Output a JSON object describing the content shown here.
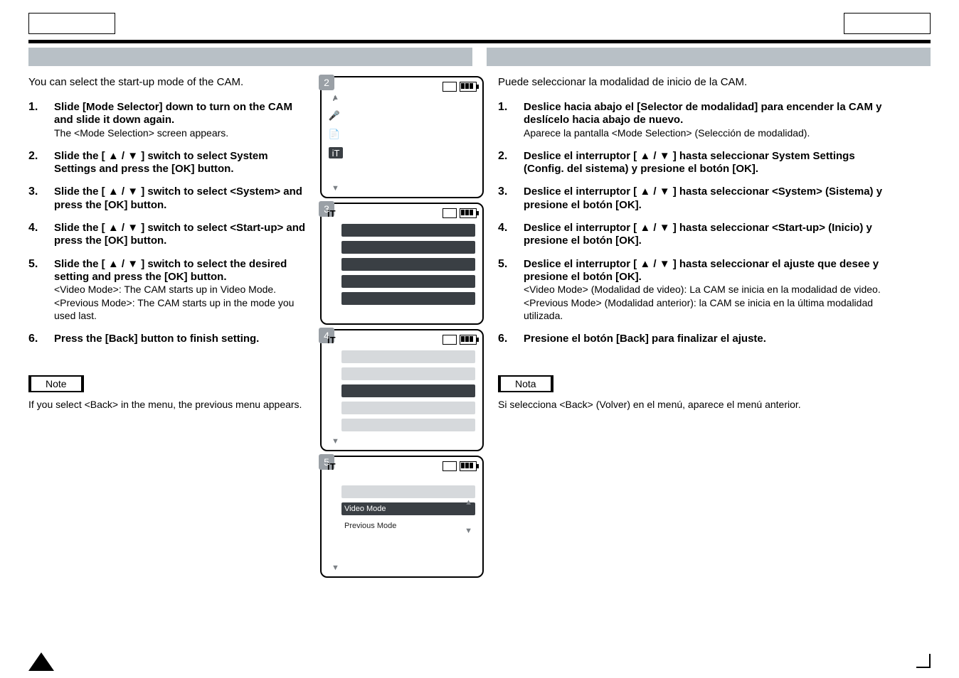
{
  "left": {
    "intro": "You can select the start-up mode of the CAM.",
    "steps": [
      {
        "n": "1.",
        "bold": "Slide [Mode Selector] down to turn on the CAM and slide it down again.",
        "sub": "The <Mode Selection> screen appears."
      },
      {
        "n": "2.",
        "bold": "Slide the [ ▲ / ▼ ] switch to select System Settings and press the [OK] button."
      },
      {
        "n": "3.",
        "bold": "Slide the [ ▲ / ▼ ] switch to select <System> and press the [OK] button."
      },
      {
        "n": "4.",
        "bold": "Slide the [ ▲ / ▼ ] switch to select <Start-up> and press the [OK] button."
      },
      {
        "n": "5.",
        "bold": "Slide the [ ▲ / ▼ ] switch to select the desired setting and press the [OK] button.",
        "sub": "<Video Mode>: The CAM starts up in Video Mode.\n<Previous Mode>: The CAM starts up in the mode you used last."
      },
      {
        "n": "6.",
        "bold": "Press the [Back] button to finish setting."
      }
    ],
    "note_label": "Note",
    "note_text": "If you select <Back> in the menu, the previous menu appears."
  },
  "right": {
    "intro": "Puede seleccionar la modalidad de inicio de la CAM.",
    "steps": [
      {
        "n": "1.",
        "bold": "Deslice hacia abajo el [Selector de modalidad] para encender la CAM y deslícelo hacia abajo de nuevo.",
        "sub": "Aparece la pantalla <Mode Selection> (Selección de modalidad)."
      },
      {
        "n": "2.",
        "bold": "Deslice el interruptor [ ▲ / ▼ ] hasta seleccionar System Settings (Config. del sistema) y presione el botón [OK]."
      },
      {
        "n": "3.",
        "bold": "Deslice el interruptor [ ▲ / ▼ ] hasta seleccionar <System> (Sistema) y presione el botón [OK]."
      },
      {
        "n": "4.",
        "bold": "Deslice el interruptor [ ▲ / ▼ ] hasta seleccionar <Start-up> (Inicio) y presione el botón [OK]."
      },
      {
        "n": "5.",
        "bold": "Deslice el interruptor [ ▲ / ▼ ] hasta seleccionar el ajuste que desee y presione el botón [OK].",
        "sub": "<Video Mode> (Modalidad de video): La CAM se inicia en la modalidad de video.\n<Previous Mode> (Modalidad anterior): la CAM se inicia en la última modalidad utilizada."
      },
      {
        "n": "6.",
        "bold": "Presione el botón [Back] para finalizar el ajuste."
      }
    ],
    "note_label": "Nota",
    "note_text": "Si selecciona <Back> (Volver) en el menú, aparece el menú anterior."
  },
  "screens": {
    "badges": [
      "2",
      "3",
      "4",
      "5"
    ],
    "options5": [
      "Video Mode",
      "Previous Mode"
    ]
  }
}
